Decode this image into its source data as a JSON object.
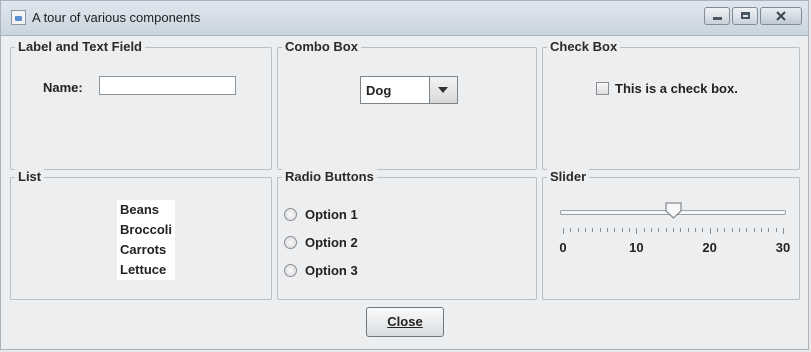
{
  "window": {
    "title": "A tour of various components",
    "controls": {
      "minimize": "minimize-icon",
      "maximize": "maximize-icon",
      "close": "close-icon"
    }
  },
  "panels": {
    "label_text_field": {
      "title": "Label and Text Field",
      "label": "Name:",
      "value": "",
      "placeholder": ""
    },
    "combo_box": {
      "title": "Combo Box",
      "selected": "Dog"
    },
    "check_box": {
      "title": "Check Box",
      "label": "This is a check box.",
      "checked": false
    },
    "list": {
      "title": "List",
      "items": [
        "Beans",
        "Broccoli",
        "Carrots",
        "Lettuce"
      ]
    },
    "radio_buttons": {
      "title": "Radio Buttons",
      "options": [
        "Option 1",
        "Option 2",
        "Option 3"
      ],
      "selected": null
    },
    "slider": {
      "title": "Slider",
      "min": 0,
      "max": 30,
      "value": 15,
      "labels": [
        "0",
        "10",
        "20",
        "30"
      ]
    }
  },
  "footer": {
    "close_label": "Close"
  }
}
